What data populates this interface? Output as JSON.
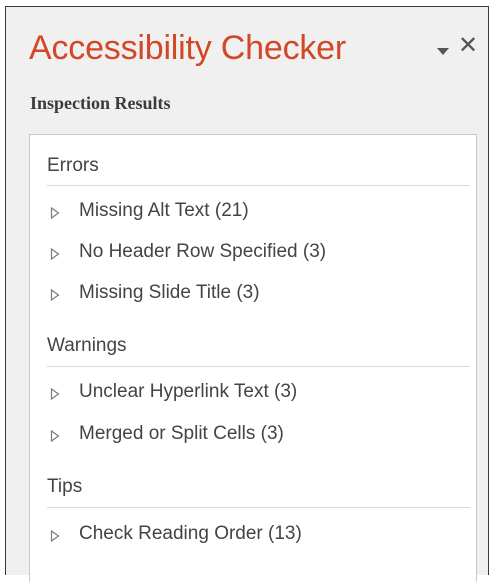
{
  "pane": {
    "title": "Accessibility Checker",
    "menu_icon": "dropdown-triangle-icon",
    "close_icon": "close-icon",
    "close_glyph": "✕",
    "subtitle": "Inspection Results",
    "accent_color": "#d24726"
  },
  "groups": [
    {
      "label": "Errors",
      "items": [
        {
          "label": "Missing Alt Text (21)"
        },
        {
          "label": "No Header Row Specified (3)"
        },
        {
          "label": "Missing Slide Title (3)"
        }
      ]
    },
    {
      "label": "Warnings",
      "items": [
        {
          "label": "Unclear Hyperlink Text (3)"
        },
        {
          "label": "Merged or Split Cells (3)"
        }
      ]
    },
    {
      "label": "Tips",
      "items": [
        {
          "label": "Check Reading Order (13)"
        }
      ]
    }
  ],
  "item_icon": "expand-triangle-icon"
}
